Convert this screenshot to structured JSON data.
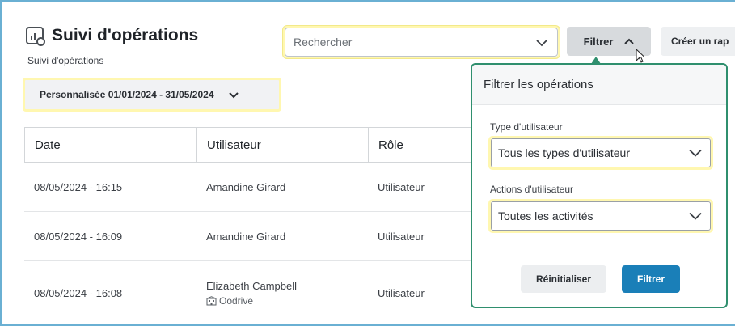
{
  "header": {
    "title": "Suivi d'opérations",
    "subtitle": "Suivi d'opérations"
  },
  "search": {
    "placeholder": "Rechercher"
  },
  "toolbar": {
    "filter_label": "Filtrer",
    "create_report_label": "Créer un rap"
  },
  "date_range": {
    "label": "Personnalisée 01/01/2024 - 31/05/2024"
  },
  "table": {
    "columns": [
      "Date",
      "Utilisateur",
      "Rôle"
    ],
    "rows": [
      {
        "date": "08/05/2024 - 16:15",
        "user": "Amandine Girard",
        "org": "",
        "role": "Utilisateur"
      },
      {
        "date": "08/05/2024 - 16:09",
        "user": "Amandine Girard",
        "org": "",
        "role": "Utilisateur"
      },
      {
        "date": "08/05/2024 - 16:08",
        "user": "Elizabeth Campbell",
        "org": "Oodrive",
        "role": "Utilisateur"
      }
    ]
  },
  "filter_panel": {
    "title": "Filtrer les opérations",
    "user_type_label": "Type d'utilisateur",
    "user_type_value": "Tous les types d'utilisateur",
    "user_actions_label": "Actions d'utilisateur",
    "user_actions_value": "Toutes les activités",
    "reset_label": "Réinitialiser",
    "apply_label": "Filtrer"
  },
  "colors": {
    "accent_green": "#2f8f6e",
    "primary_blue": "#1a7fb8",
    "highlight_yellow": "#fff7b0"
  }
}
